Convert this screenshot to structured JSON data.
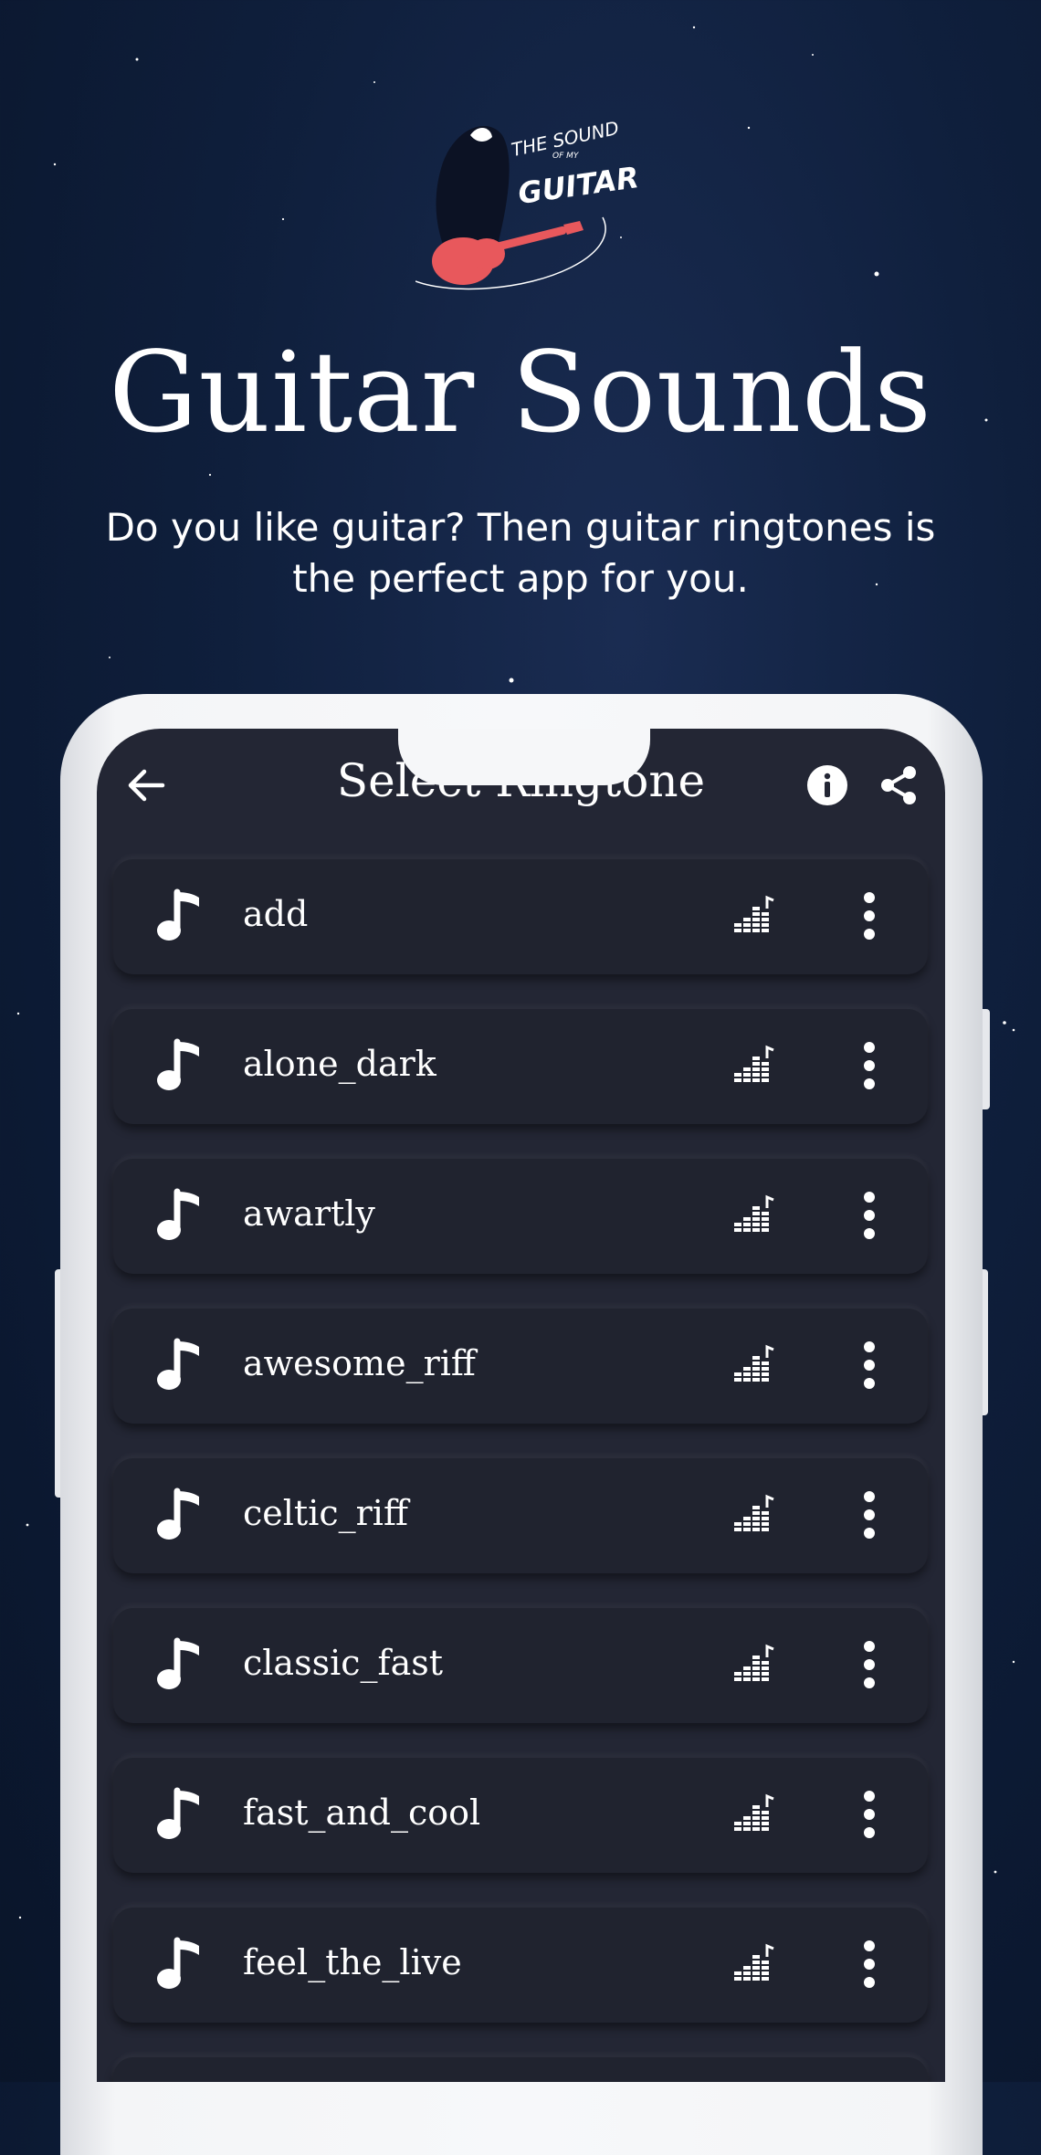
{
  "promo": {
    "logo": {
      "line1": "THE SOUND",
      "line2": "OF MY",
      "line3": "GUITAR"
    },
    "headline": "Guitar Sounds",
    "subtext": "Do you like guitar? Then guitar ringtones is the perfect app for you."
  },
  "app": {
    "title": "Select Ringtone",
    "icons": {
      "back": "arrow-left-icon",
      "info": "info-icon",
      "share": "share-icon",
      "note": "music-note-icon",
      "equalizer": "equalizer-icon",
      "more": "more-vert-icon"
    },
    "ringtones": [
      {
        "name": "add"
      },
      {
        "name": "alone_dark"
      },
      {
        "name": "awartly"
      },
      {
        "name": "awesome_riff"
      },
      {
        "name": "celtic_riff"
      },
      {
        "name": "classic_fast"
      },
      {
        "name": "fast_and_cool"
      },
      {
        "name": "feel_the_live"
      },
      {
        "name": ""
      }
    ]
  },
  "colors": {
    "background": "#0f1f3c",
    "screen": "#232634",
    "row": "#20232f",
    "guitar": "#e8585c",
    "text": "#ffffff"
  }
}
